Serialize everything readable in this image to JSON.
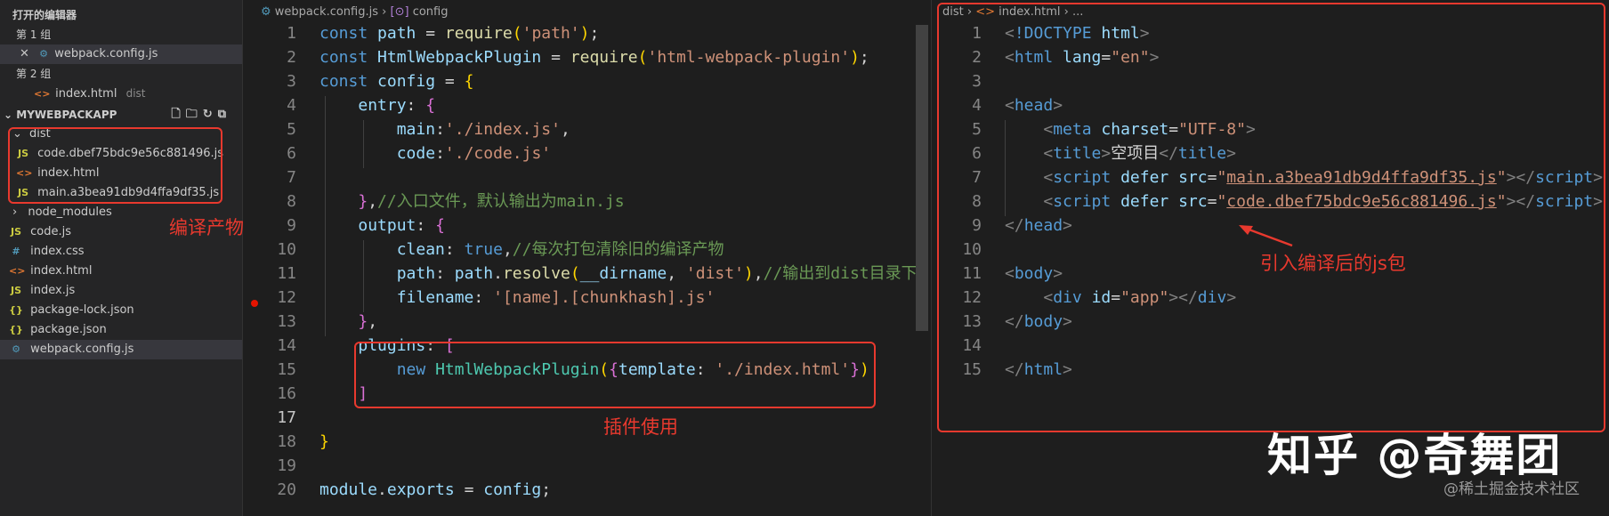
{
  "sidebar": {
    "open_editors_title": "打开的编辑器",
    "group1": "第 1 组",
    "group1_file": "webpack.config.js",
    "group2": "第 2 组",
    "group2_file": "index.html",
    "group2_file_desc": "dist",
    "project_title": "MYWEBPACKAPP",
    "toolbar_icons": [
      "new-file-icon",
      "new-folder-icon",
      "refresh-icon",
      "collapse-icon"
    ],
    "dist_folder": "dist",
    "dist_files": [
      "code.dbef75bdc9e56c881496.js",
      "index.html",
      "main.a3bea91db9d4ffa9df35.js"
    ],
    "files": [
      "node_modules",
      "code.js",
      "index.css",
      "index.html",
      "index.js",
      "package-lock.json",
      "package.json",
      "webpack.config.js"
    ]
  },
  "editor": {
    "breadcrumb_file": "webpack.config.js",
    "breadcrumb_symbol": "config",
    "line_numbers": [
      "1",
      "2",
      "3",
      "4",
      "5",
      "6",
      "7",
      "8",
      "9",
      "10",
      "11",
      "12",
      "13",
      "14",
      "15",
      "16",
      "17",
      "18",
      "19",
      "20"
    ],
    "lines": [
      [
        [
          "kw",
          "const "
        ],
        [
          "var",
          "path"
        ],
        [
          "pn",
          " = "
        ],
        [
          "fn",
          "require"
        ],
        [
          "br",
          "("
        ],
        [
          "str",
          "'path'"
        ],
        [
          "br",
          ")"
        ],
        [
          "pn",
          ";"
        ]
      ],
      [
        [
          "kw",
          "const "
        ],
        [
          "var",
          "HtmlWebpackPlugin"
        ],
        [
          "pn",
          " = "
        ],
        [
          "fn",
          "require"
        ],
        [
          "br",
          "("
        ],
        [
          "str",
          "'html-webpack-plugin'"
        ],
        [
          "br",
          ")"
        ],
        [
          "pn",
          ";"
        ]
      ],
      [
        [
          "kw",
          "const "
        ],
        [
          "var",
          "config"
        ],
        [
          "pn",
          " = "
        ],
        [
          "br",
          "{"
        ]
      ],
      [
        [
          "pn",
          "    "
        ],
        [
          "var",
          "entry"
        ],
        [
          "pn",
          ": "
        ],
        [
          "br2",
          "{"
        ]
      ],
      [
        [
          "pn",
          "        "
        ],
        [
          "var",
          "main"
        ],
        [
          "pn",
          ":"
        ],
        [
          "str",
          "'./index.js'"
        ],
        [
          "pn",
          ","
        ]
      ],
      [
        [
          "pn",
          "        "
        ],
        [
          "var",
          "code"
        ],
        [
          "pn",
          ":"
        ],
        [
          "str",
          "'./code.js'"
        ]
      ],
      [],
      [
        [
          "pn",
          "    "
        ],
        [
          "br2",
          "}"
        ],
        [
          "pn",
          ","
        ],
        [
          "cm",
          "//入口文件，默认输出为main.js"
        ]
      ],
      [
        [
          "pn",
          "    "
        ],
        [
          "var",
          "output"
        ],
        [
          "pn",
          ": "
        ],
        [
          "br2",
          "{"
        ]
      ],
      [
        [
          "pn",
          "        "
        ],
        [
          "var",
          "clean"
        ],
        [
          "pn",
          ": "
        ],
        [
          "tr",
          "true"
        ],
        [
          "pn",
          ","
        ],
        [
          "cm",
          "//每次打包清除旧的编译产物"
        ]
      ],
      [
        [
          "pn",
          "        "
        ],
        [
          "var",
          "path"
        ],
        [
          "pn",
          ": "
        ],
        [
          "var",
          "path"
        ],
        [
          "pn",
          "."
        ],
        [
          "fn",
          "resolve"
        ],
        [
          "br",
          "("
        ],
        [
          "var",
          "__dirname"
        ],
        [
          "pn",
          ", "
        ],
        [
          "str",
          "'dist'"
        ],
        [
          "br",
          ")"
        ],
        [
          "pn",
          ","
        ],
        [
          "cm",
          "//输出到dist目录下"
        ]
      ],
      [
        [
          "pn",
          "        "
        ],
        [
          "var",
          "filename"
        ],
        [
          "pn",
          ": "
        ],
        [
          "str",
          "'[name].[chunkhash].js'"
        ]
      ],
      [
        [
          "pn",
          "    "
        ],
        [
          "br2",
          "}"
        ],
        [
          "pn",
          ","
        ]
      ],
      [
        [
          "pn",
          "    "
        ],
        [
          "var",
          "plugins"
        ],
        [
          "pn",
          ": "
        ],
        [
          "br2",
          "["
        ]
      ],
      [
        [
          "pn",
          "        "
        ],
        [
          "kw",
          "new "
        ],
        [
          "cls",
          "HtmlWebpackPlugin"
        ],
        [
          "br",
          "("
        ],
        [
          "br2",
          "{"
        ],
        [
          "var",
          "template"
        ],
        [
          "pn",
          ": "
        ],
        [
          "str",
          "'./index.html'"
        ],
        [
          "br2",
          "}"
        ],
        [
          "br",
          ")"
        ]
      ],
      [
        [
          "pn",
          "    "
        ],
        [
          "br2",
          "]"
        ]
      ],
      [],
      [
        [
          "br",
          "}"
        ]
      ],
      [],
      [
        [
          "var",
          "module"
        ],
        [
          "pn",
          "."
        ],
        [
          "var",
          "exports"
        ],
        [
          "pn",
          " = "
        ],
        [
          "var",
          "config"
        ],
        [
          "pn",
          ";"
        ]
      ]
    ]
  },
  "preview": {
    "breadcrumb_folder": "dist",
    "breadcrumb_file": "index.html",
    "breadcrumb_more": "...",
    "line_numbers": [
      "1",
      "2",
      "3",
      "4",
      "5",
      "6",
      "7",
      "8",
      "9",
      "10",
      "11",
      "12",
      "13",
      "14",
      "15"
    ],
    "lines": [
      [
        [
          "ang",
          "<"
        ],
        [
          "tag",
          "!DOCTYPE "
        ],
        [
          "at",
          "html"
        ],
        [
          "ang",
          ">"
        ]
      ],
      [
        [
          "ang",
          "<"
        ],
        [
          "tag",
          "html "
        ],
        [
          "at",
          "lang"
        ],
        [
          "pn",
          "="
        ],
        [
          "av",
          "\"en\""
        ],
        [
          "ang",
          ">"
        ]
      ],
      [],
      [
        [
          "ang",
          "<"
        ],
        [
          "tag",
          "head"
        ],
        [
          "ang",
          ">"
        ]
      ],
      [
        [
          "pn",
          "    "
        ],
        [
          "ang",
          "<"
        ],
        [
          "tag",
          "meta "
        ],
        [
          "at",
          "charset"
        ],
        [
          "pn",
          "="
        ],
        [
          "av",
          "\"UTF-8\""
        ],
        [
          "ang",
          ">"
        ]
      ],
      [
        [
          "pn",
          "    "
        ],
        [
          "ang",
          "<"
        ],
        [
          "tag",
          "title"
        ],
        [
          "ang",
          ">"
        ],
        [
          "pn",
          "空项目"
        ],
        [
          "ang",
          "</"
        ],
        [
          "tag",
          "title"
        ],
        [
          "ang",
          ">"
        ]
      ],
      [
        [
          "pn",
          "    "
        ],
        [
          "ang",
          "<"
        ],
        [
          "tag",
          "script "
        ],
        [
          "at",
          "defer "
        ],
        [
          "at",
          "src"
        ],
        [
          "pn",
          "="
        ],
        [
          "av",
          "\""
        ],
        [
          "avl",
          "main.a3bea91db9d4ffa9df35.js"
        ],
        [
          "av",
          "\""
        ],
        [
          "ang",
          "></"
        ],
        [
          "tag",
          "script"
        ],
        [
          "ang",
          ">"
        ]
      ],
      [
        [
          "pn",
          "    "
        ],
        [
          "ang",
          "<"
        ],
        [
          "tag",
          "script "
        ],
        [
          "at",
          "defer "
        ],
        [
          "at",
          "src"
        ],
        [
          "pn",
          "="
        ],
        [
          "av",
          "\""
        ],
        [
          "avl",
          "code.dbef75bdc9e56c881496.js"
        ],
        [
          "av",
          "\""
        ],
        [
          "ang",
          "></"
        ],
        [
          "tag",
          "script"
        ],
        [
          "ang",
          ">"
        ]
      ],
      [
        [
          "ang",
          "</"
        ],
        [
          "tag",
          "head"
        ],
        [
          "ang",
          ">"
        ]
      ],
      [],
      [
        [
          "ang",
          "<"
        ],
        [
          "tag",
          "body"
        ],
        [
          "ang",
          ">"
        ]
      ],
      [
        [
          "pn",
          "    "
        ],
        [
          "ang",
          "<"
        ],
        [
          "tag",
          "div "
        ],
        [
          "at",
          "id"
        ],
        [
          "pn",
          "="
        ],
        [
          "av",
          "\"app\""
        ],
        [
          "ang",
          "></"
        ],
        [
          "tag",
          "div"
        ],
        [
          "ang",
          ">"
        ]
      ],
      [
        [
          "ang",
          "</"
        ],
        [
          "tag",
          "body"
        ],
        [
          "ang",
          ">"
        ]
      ],
      [],
      [
        [
          "ang",
          "</"
        ],
        [
          "tag",
          "html"
        ],
        [
          "ang",
          ">"
        ]
      ]
    ]
  },
  "annotations": {
    "build_output": "编译产物",
    "plugin_usage": "插件使用",
    "import_bundle": "引入编译后的js包"
  },
  "watermark": {
    "main": "知乎 @奇舞团",
    "sub": "@稀土掘金技术社区"
  },
  "colors": {
    "annotation": "#e8392e",
    "background": "#1e1e1e",
    "sidebar": "#252526"
  }
}
